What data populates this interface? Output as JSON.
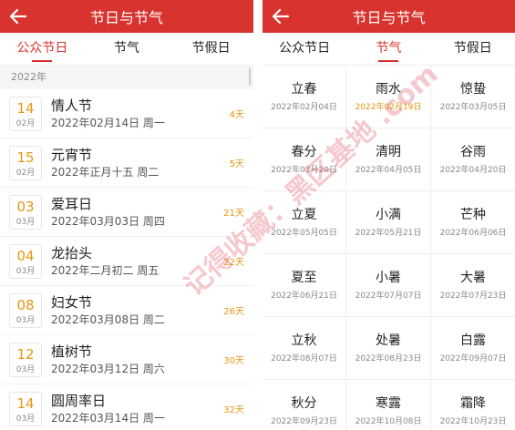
{
  "left": {
    "title": "节日与节气",
    "tabs": [
      {
        "label": "公众节日",
        "active": true
      },
      {
        "label": "节气",
        "active": false
      },
      {
        "label": "节假日",
        "active": false
      }
    ],
    "year_header": "2022年",
    "festivals": [
      {
        "day": "14",
        "month": "02月",
        "name": "情人节",
        "date": "2022年02月14日 周一",
        "countdown": "4天"
      },
      {
        "day": "15",
        "month": "02月",
        "name": "元宵节",
        "date": "2022年正月十五 周二",
        "countdown": "5天"
      },
      {
        "day": "03",
        "month": "03月",
        "name": "爱耳日",
        "date": "2022年03月03日 周四",
        "countdown": "21天"
      },
      {
        "day": "04",
        "month": "03月",
        "name": "龙抬头",
        "date": "2022年二月初二 周五",
        "countdown": "22天"
      },
      {
        "day": "08",
        "month": "03月",
        "name": "妇女节",
        "date": "2022年03月08日 周二",
        "countdown": "26天"
      },
      {
        "day": "12",
        "month": "03月",
        "name": "植树节",
        "date": "2022年03月12日 周六",
        "countdown": "30天"
      },
      {
        "day": "14",
        "month": "03月",
        "name": "圆周率日",
        "date": "2022年03月14日 周一",
        "countdown": "32天"
      }
    ]
  },
  "right": {
    "title": "节日与节气",
    "tabs": [
      {
        "label": "公众节日",
        "active": false
      },
      {
        "label": "节气",
        "active": true
      },
      {
        "label": "节假日",
        "active": false
      }
    ],
    "terms": [
      {
        "name": "立春",
        "date": "2022年02月04日",
        "highlight": false
      },
      {
        "name": "雨水",
        "date": "2022年02月19日",
        "highlight": true
      },
      {
        "name": "惊蛰",
        "date": "2022年03月05日",
        "highlight": false
      },
      {
        "name": "春分",
        "date": "2022年03月20日",
        "highlight": false
      },
      {
        "name": "清明",
        "date": "2022年04月05日",
        "highlight": false
      },
      {
        "name": "谷雨",
        "date": "2022年04月20日",
        "highlight": false
      },
      {
        "name": "立夏",
        "date": "2022年05月05日",
        "highlight": false
      },
      {
        "name": "小满",
        "date": "2022年05月21日",
        "highlight": false
      },
      {
        "name": "芒种",
        "date": "2022年06月06日",
        "highlight": false
      },
      {
        "name": "夏至",
        "date": "2022年06月21日",
        "highlight": false
      },
      {
        "name": "小暑",
        "date": "2022年07月07日",
        "highlight": false
      },
      {
        "name": "大暑",
        "date": "2022年07月23日",
        "highlight": false
      },
      {
        "name": "立秋",
        "date": "2022年08月07日",
        "highlight": false
      },
      {
        "name": "处暑",
        "date": "2022年08月23日",
        "highlight": false
      },
      {
        "name": "白露",
        "date": "2022年09月07日",
        "highlight": false
      },
      {
        "name": "秋分",
        "date": "2022年09月23日",
        "highlight": false
      },
      {
        "name": "寒露",
        "date": "2022年10月08日",
        "highlight": false
      },
      {
        "name": "霜降",
        "date": "2022年10月23日",
        "highlight": false
      }
    ]
  },
  "watermark": "记得收藏：黑区基地 .com",
  "colors": {
    "brand_red": "#d8332e",
    "accent_orange": "#e8940f"
  }
}
